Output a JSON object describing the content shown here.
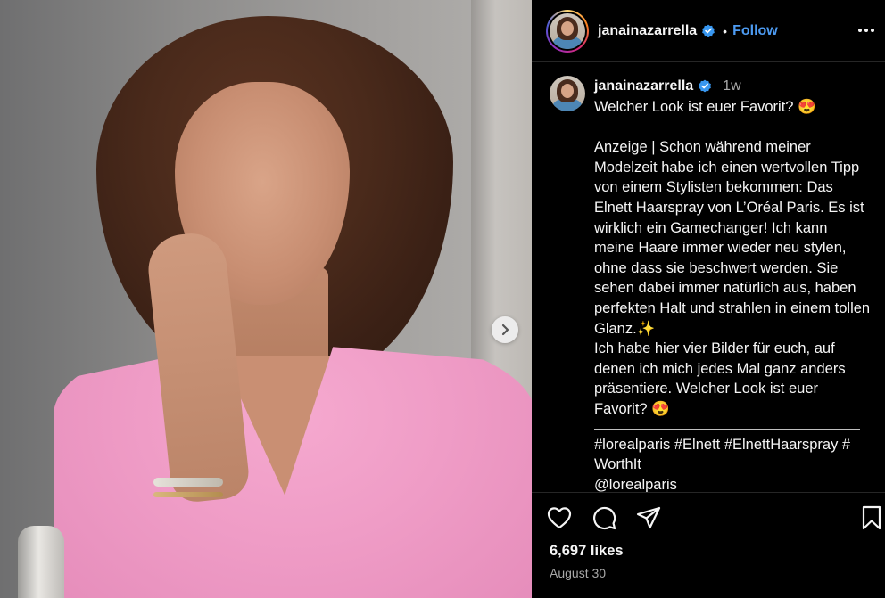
{
  "post": {
    "username": "janainazarrella",
    "follow_label": "Follow",
    "separator": "•",
    "time_ago": "1w",
    "caption": "Welcher Look ist euer Favorit? 😍\n\nAnzeige | Schon während meiner Modelzeit habe ich einen wertvollen Tipp von einem Stylisten bekommen: Das Elnett Haarspray von L’Oréal Paris. Es ist wirklich ein Gamechanger! Ich kann meine Haare immer wieder neu stylen, ohne dass sie beschwert werden. Sie sehen dabei immer natürlich aus, haben perfekten Halt und strahlen in einem tollen Glanz.✨\nIch habe hier vier Bilder für euch, auf denen ich mich jedes Mal ganz anders präsentiere. Welcher Look ist euer Favorit? 😍",
    "hashtags": "#lorealparis #Elnett #ElnettHaarspray # WorthIt\n@lorealparis",
    "likes": "6,697 likes",
    "date": "August 30"
  },
  "icons": {
    "verified": "verified-badge-icon",
    "more": "more-options-icon",
    "like": "heart-icon",
    "comment": "comment-icon",
    "share": "share-icon",
    "save": "bookmark-icon",
    "next": "chevron-right-icon"
  },
  "colors": {
    "background": "#000000",
    "link_blue": "#4d9bf2",
    "verified_blue": "#3897f0",
    "secondary_text": "#a8a8a8"
  }
}
